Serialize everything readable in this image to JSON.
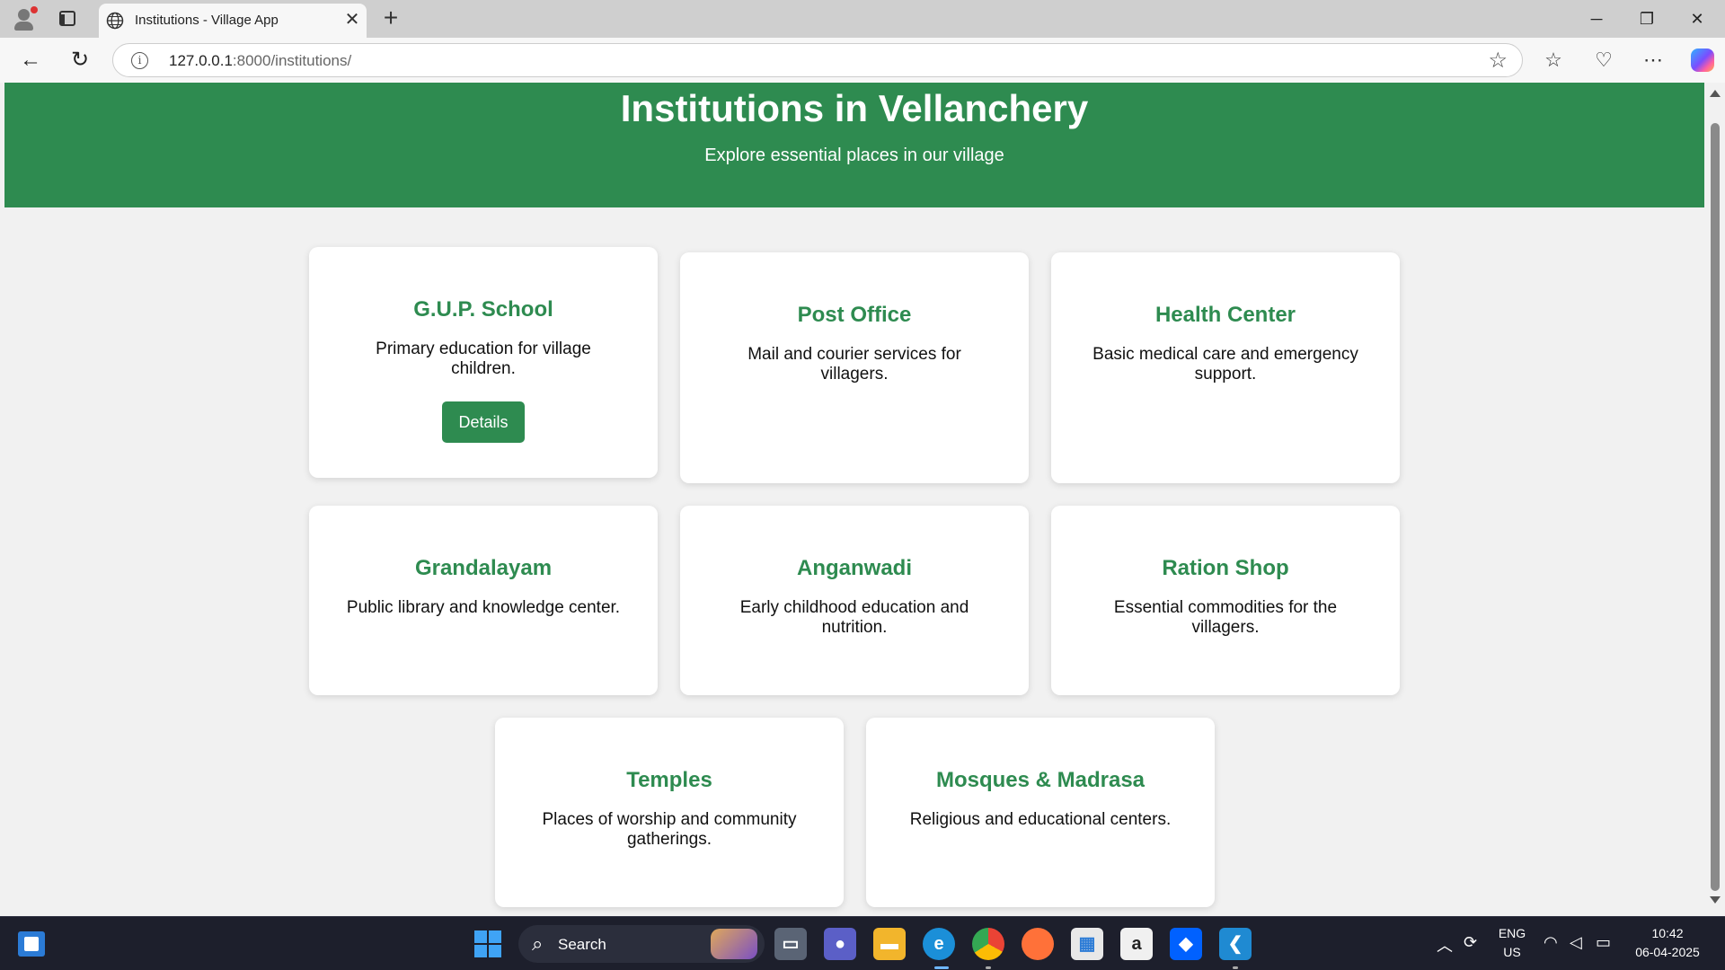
{
  "browser": {
    "tab_title": "Institutions - Village App",
    "url_host": "127.0.0.1",
    "url_path": ":8000/institutions/"
  },
  "hero": {
    "title": "Institutions in Vellanchery",
    "subtitle": "Explore essential places in our village",
    "color": "#2e8b50"
  },
  "cards": [
    {
      "title": "G.U.P. School",
      "desc": "Primary education for village children.",
      "button": "Details"
    },
    {
      "title": "Post Office",
      "desc": "Mail and courier services for villagers."
    },
    {
      "title": "Health Center",
      "desc": "Basic medical care and emergency support."
    },
    {
      "title": "Grandalayam",
      "desc": "Public library and knowledge center."
    },
    {
      "title": "Anganwadi",
      "desc": "Early childhood education and nutrition."
    },
    {
      "title": "Ration Shop",
      "desc": "Essential commodities for the villagers."
    },
    {
      "title": "Temples",
      "desc": "Places of worship and community gatherings."
    },
    {
      "title": "Mosques & Madrasa",
      "desc": "Religious and educational centers."
    }
  ],
  "taskbar": {
    "search_label": "Search",
    "lang_top": "ENG",
    "lang_bottom": "US",
    "time": "10:42",
    "date": "06-04-2025"
  }
}
